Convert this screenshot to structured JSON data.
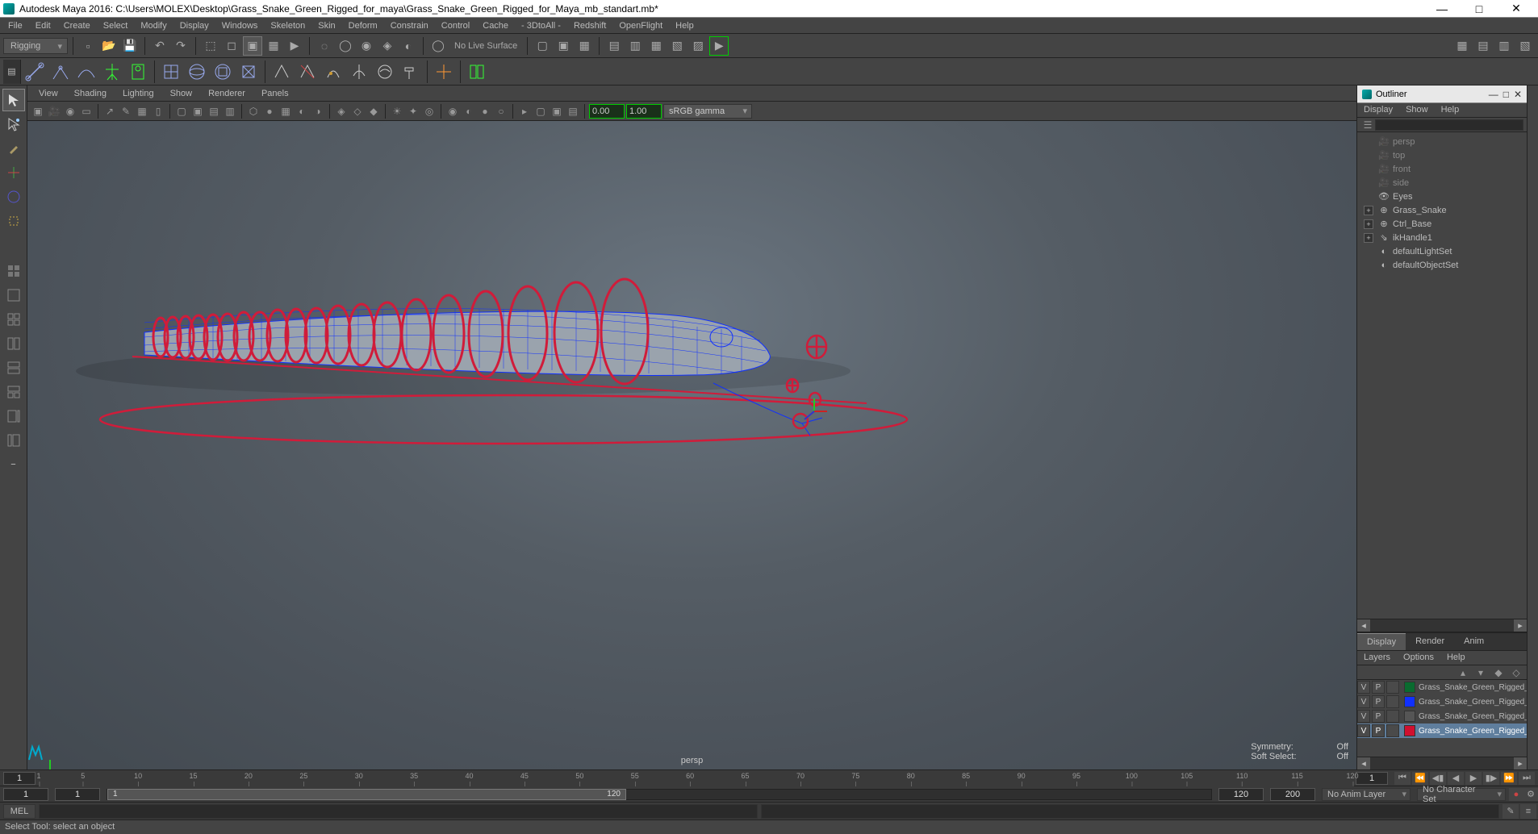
{
  "titlebar": {
    "app": "Autodesk Maya 2016",
    "filepath": "C:\\Users\\MOLEX\\Desktop\\Grass_Snake_Green_Rigged_for_maya\\Grass_Snake_Green_Rigged_for_Maya_mb_standart.mb*"
  },
  "main_menu": [
    "File",
    "Edit",
    "Create",
    "Select",
    "Modify",
    "Display",
    "Windows",
    "Skeleton",
    "Skin",
    "Deform",
    "Constrain",
    "Control",
    "Cache",
    "- 3DtoAll -",
    "Redshift",
    "OpenFlight",
    "Help"
  ],
  "workspace_dropdown": "Rigging",
  "no_live_surface": "No Live Surface",
  "panel_menus": [
    "View",
    "Shading",
    "Lighting",
    "Show",
    "Renderer",
    "Panels"
  ],
  "gamma_field": "0.00",
  "exposure_field": "1.00",
  "color_space": "sRGB gamma",
  "viewport": {
    "camera": "persp",
    "symmetry_label": "Symmetry:",
    "symmetry_value": "Off",
    "softselect_label": "Soft Select:",
    "softselect_value": "Off"
  },
  "outliner": {
    "title": "Outliner",
    "menus": [
      "Display",
      "Show",
      "Help"
    ],
    "search_placeholder": "",
    "items": [
      {
        "name": "persp",
        "dim": true,
        "icon": "cam"
      },
      {
        "name": "top",
        "dim": true,
        "icon": "cam"
      },
      {
        "name": "front",
        "dim": true,
        "icon": "cam"
      },
      {
        "name": "side",
        "dim": true,
        "icon": "cam"
      },
      {
        "name": "Eyes",
        "icon": "eye"
      },
      {
        "name": "Grass_Snake",
        "icon": "group",
        "expand": true
      },
      {
        "name": "Ctrl_Base",
        "icon": "group",
        "expand": true
      },
      {
        "name": "ikHandle1",
        "icon": "ik",
        "expand": true
      },
      {
        "name": "defaultLightSet",
        "icon": "set"
      },
      {
        "name": "defaultObjectSet",
        "icon": "set"
      }
    ]
  },
  "layers": {
    "tabs": [
      "Display",
      "Render",
      "Anim"
    ],
    "menus": [
      "Layers",
      "Options",
      "Help"
    ],
    "rows": [
      {
        "v": "V",
        "p": "P",
        "color": "#0a6b2f",
        "name": "Grass_Snake_Green_Rigged_hel"
      },
      {
        "v": "V",
        "p": "P",
        "color": "#1030ff",
        "name": "Grass_Snake_Green_Rigged_bor"
      },
      {
        "v": "V",
        "p": "P",
        "color": "#555555",
        "name": "Grass_Snake_Green_Rigged_Rig"
      },
      {
        "v": "V",
        "p": "P",
        "color": "#d01030",
        "name": "Grass_Snake_Green_Rigged_con",
        "selected": true
      }
    ]
  },
  "timeline": {
    "start": "1",
    "end_playback": "1",
    "ticks": [
      1,
      5,
      10,
      15,
      20,
      25,
      30,
      35,
      40,
      45,
      50,
      55,
      60,
      65,
      70,
      75,
      80,
      85,
      90,
      95,
      100,
      105,
      110,
      115,
      120
    ],
    "current_display": "1"
  },
  "range": {
    "outer_start": "1",
    "inner_start": "1",
    "inner_label_left": "1",
    "inner_label_right": "120",
    "inner_end": "120",
    "outer_end": "200",
    "anim_layer": "No Anim Layer",
    "char_set": "No Character Set"
  },
  "cmdline": {
    "lang": "MEL"
  },
  "helpline": "Select Tool: select an object"
}
